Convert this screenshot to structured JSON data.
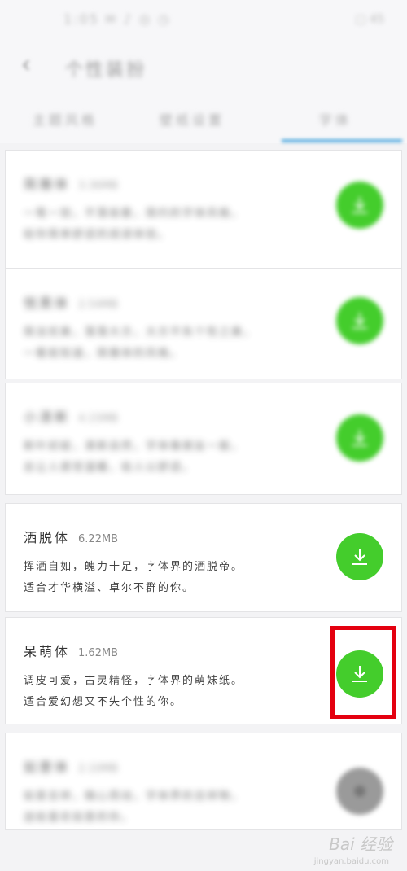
{
  "statusbar": {
    "left": "1:05 ✉ ♪ ◎ ◷",
    "right": "▢ 45"
  },
  "header": {
    "title": "个性装扮"
  },
  "tabs": [
    "主题风格",
    "壁纸设置",
    "字体"
  ],
  "fonts": [
    {
      "name": "简雅体",
      "size": "3.36MB",
      "desc1": "一笔一划，不落俗套，简约的字体风格，",
      "desc2": "给你简单舒适的阅读体验。"
    },
    {
      "name": "悦黑体",
      "size": "2.54MB",
      "desc1": "简洁优美，落落大方，大方不失个性之美，",
      "desc2": "一看就知道，简雅体的风格。"
    },
    {
      "name": "小清新",
      "size": "4.15MB",
      "desc1": "新叶初绽，清新自然，字体像朋友一般，",
      "desc2": "总让人感觉温暖，给人以舒适。"
    },
    {
      "name": "洒脱体",
      "size": "6.22MB",
      "desc1": "挥洒自如，魄力十足，字体界的洒脱帝。",
      "desc2": "适合才华横溢、卓尔不群的你。"
    },
    {
      "name": "呆萌体",
      "size": "1.62MB",
      "desc1": "调皮可爱，古灵精怪，字体界的萌妹纸。",
      "desc2": "适合爱幻想又不失个性的你。"
    },
    {
      "name": "如意体",
      "size": "2.10MB",
      "desc1": "如意吉祥，随心而动，字体界的吉祥物，",
      "desc2": "送给喜欢如意的你。"
    }
  ],
  "colors": {
    "download": "#44cd2c",
    "tab_indicator": "#5aaee0",
    "highlight": "#e4000f"
  },
  "watermark": {
    "brand": "Bai 经验",
    "url": "jingyan.baidu.com"
  }
}
